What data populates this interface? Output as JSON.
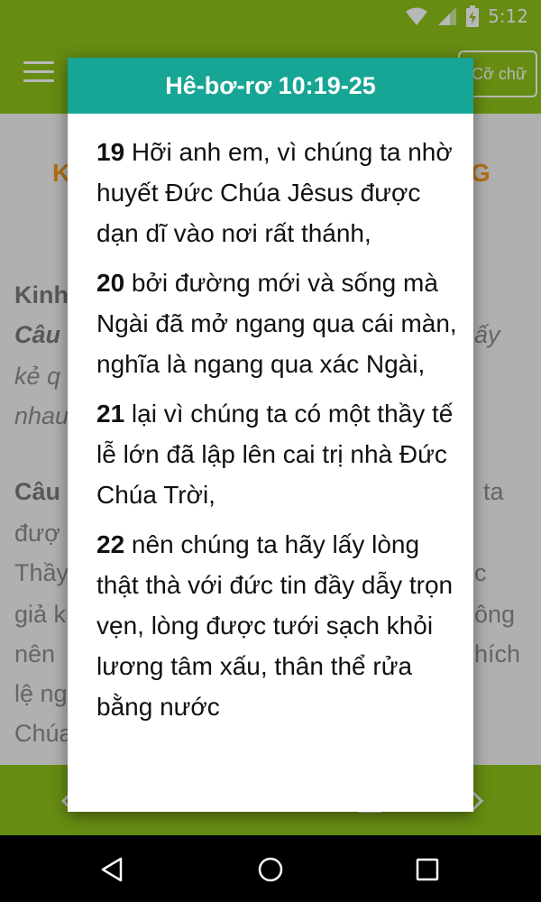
{
  "status_bar": {
    "time": "5:12"
  },
  "app_bar": {
    "font_button_label": "Cỡ chữ"
  },
  "background": {
    "heading_left": "K",
    "heading_right": "G",
    "lines": [
      {
        "left": "Kinh",
        "right": ""
      },
      {
        "left": "Câu",
        "right": "ấy"
      },
      {
        "left": "kẻ q",
        "right": ""
      },
      {
        "left": "nhau",
        "right": ""
      },
      {
        "left": "Câu",
        "right": "ta"
      },
      {
        "left": "đượ",
        "right": ""
      },
      {
        "left": "Thầy",
        "right": "c"
      },
      {
        "left": "giả k",
        "right": "ông"
      },
      {
        "left": "nên",
        "right": "hích"
      },
      {
        "left": "lệ ng",
        "right": ""
      },
      {
        "left": "Chúa",
        "right": ""
      }
    ]
  },
  "dialog": {
    "title": "Hê-bơ-rơ 10:19-25",
    "verses": [
      {
        "num": "19",
        "text": "  Hỡi anh em, vì chúng ta nhờ huyết Đức Chúa Jêsus được dạn dĩ vào nơi rất thánh,"
      },
      {
        "num": "20",
        "text": " bởi đường mới và sống mà Ngài đã mở ngang qua cái màn, nghĩa là ngang qua xác Ngài,"
      },
      {
        "num": "21",
        "text": " lại vì chúng ta có một thầy tế lễ lớn đã lập lên cai trị nhà Đức Chúa Trời,"
      },
      {
        "num": "22",
        "text": " nên chúng ta hãy lấy lòng thật thà với đức tin đầy dẫy trọn vẹn, lòng được tưới sạch khỏi lương tâm xấu, thân thể rửa bằng nước"
      }
    ]
  }
}
